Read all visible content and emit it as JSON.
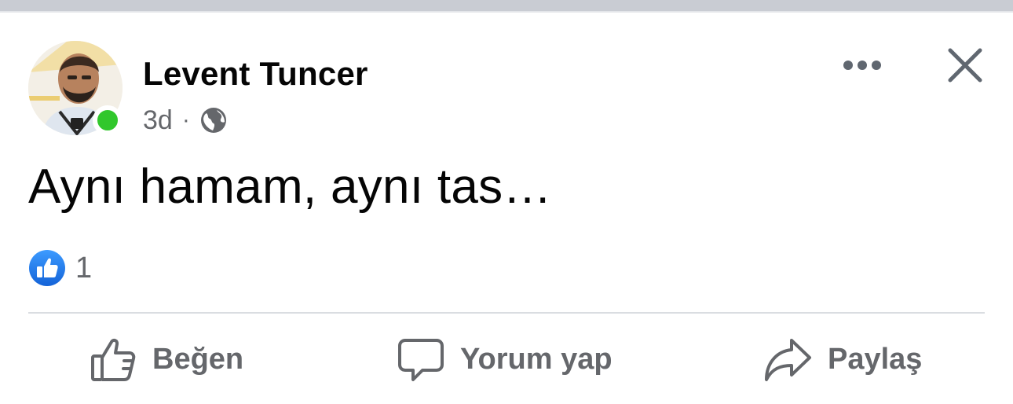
{
  "post": {
    "author": "Levent Tuncer",
    "time": "3d",
    "separator": "·",
    "audience_icon": "globe-icon",
    "text": "Aynı hamam, aynı tas…",
    "reactions": {
      "icon": "like-icon",
      "count": "1"
    }
  },
  "header_actions": {
    "more_icon": "more-horizontal-icon",
    "close_icon": "close-icon"
  },
  "actions": {
    "like_label": "Beğen",
    "comment_label": "Yorum yap",
    "share_label": "Paylaş"
  },
  "colors": {
    "primary_text": "#050505",
    "secondary_text": "#65676b",
    "like_blue": "#1877f2",
    "online_green": "#31c72c",
    "divider": "#dadde1"
  }
}
